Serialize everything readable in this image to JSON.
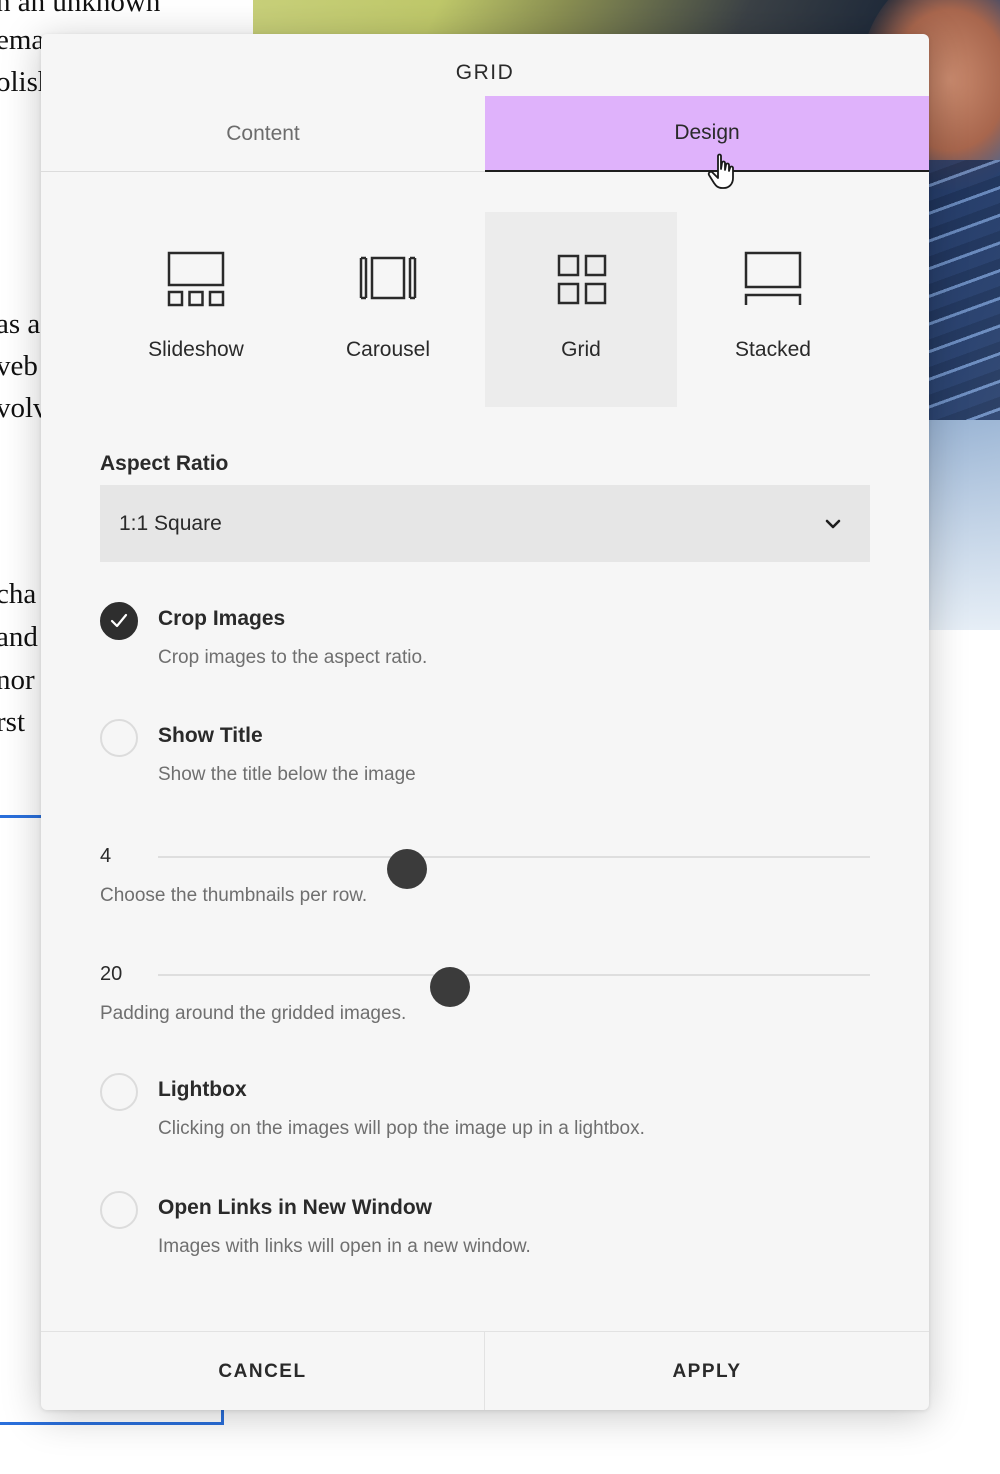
{
  "background": {
    "text_fragments": [
      "n an unknown",
      "ema",
      "olish",
      "as a",
      "veb",
      "volv",
      "cha",
      "and",
      "nor",
      "rst"
    ]
  },
  "modal": {
    "title": "GRID",
    "tabs": [
      {
        "label": "Content",
        "active": false
      },
      {
        "label": "Design",
        "active": true
      }
    ],
    "active_tab_color": "#dfb2fb",
    "layouts": [
      {
        "label": "Slideshow",
        "icon": "slideshow-icon",
        "selected": false
      },
      {
        "label": "Carousel",
        "icon": "carousel-icon",
        "selected": false
      },
      {
        "label": "Grid",
        "icon": "grid-icon",
        "selected": true
      },
      {
        "label": "Stacked",
        "icon": "stacked-icon",
        "selected": false
      }
    ],
    "aspect_ratio": {
      "label": "Aspect Ratio",
      "value": "1:1 Square"
    },
    "options": {
      "crop_images": {
        "title": "Crop Images",
        "description": "Crop images to the aspect ratio.",
        "checked": true
      },
      "show_title": {
        "title": "Show Title",
        "description": "Show the title below the image",
        "checked": false
      },
      "lightbox": {
        "title": "Lightbox",
        "description": "Clicking on the images will pop the image up in a lightbox.",
        "checked": false
      },
      "open_links": {
        "title": "Open Links in New Window",
        "description": "Images with links will open in a new window.",
        "checked": false
      }
    },
    "sliders": {
      "thumbnails": {
        "value": "4",
        "description": "Choose the thumbnails per row.",
        "fraction": 0.35
      },
      "padding": {
        "value": "20",
        "description": "Padding around the gridded images.",
        "fraction": 0.41
      }
    },
    "footer": {
      "cancel_label": "CANCEL",
      "apply_label": "APPLY"
    }
  }
}
